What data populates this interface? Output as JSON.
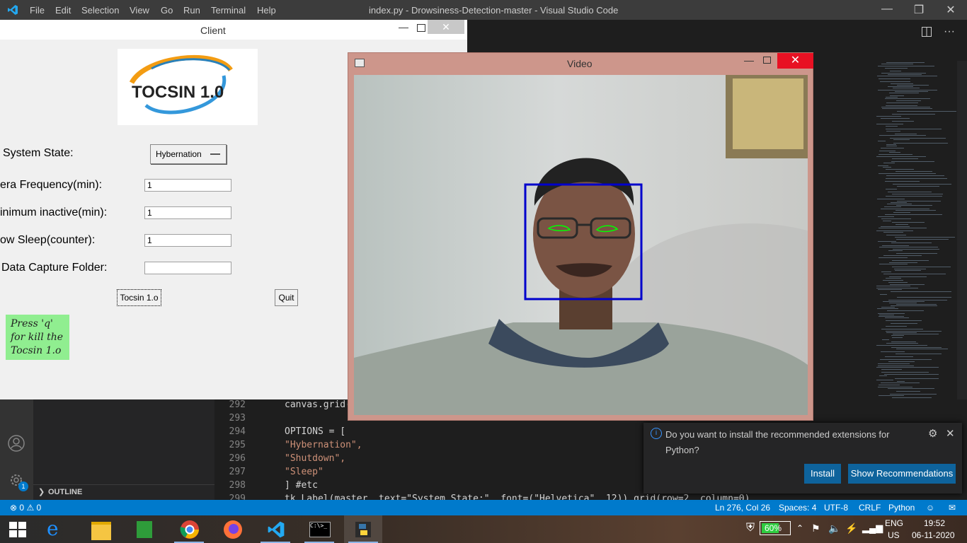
{
  "vscode": {
    "menu": [
      "File",
      "Edit",
      "Selection",
      "View",
      "Go",
      "Run",
      "Terminal",
      "Help"
    ],
    "title": "index.py - Drowsiness-Detection-master - Visual Studio Code",
    "outline_label": "OUTLINE",
    "settings_badge": "1",
    "editor_lines": [
      {
        "num": "292",
        "code": "canvas.grid("
      },
      {
        "num": "293",
        "code": ""
      },
      {
        "num": "294",
        "code": "OPTIONS = ["
      },
      {
        "num": "295",
        "code": "\"Hybernation\","
      },
      {
        "num": "296",
        "code": "\"Shutdown\","
      },
      {
        "num": "297",
        "code": "\"Sleep\""
      },
      {
        "num": "298",
        "code": "] #etc"
      },
      {
        "num": "299",
        "code": "tk.Label(master, text=\"System State:\", font=(\"Helvetica\", 12)).grid(row=2, column=0)"
      }
    ],
    "status": {
      "errors": "0",
      "warnings": "0",
      "position": "Ln 276, Col 26",
      "spaces": "Spaces: 4",
      "encoding": "UTF-8",
      "eol": "CRLF",
      "language": "Python"
    },
    "notification": {
      "message": "Do you want to install the recommended extensions for Python?",
      "install": "Install",
      "show_recommendations": "Show Recommendations"
    }
  },
  "client": {
    "title": "Client",
    "logo_text": "TOCSIN 1.0",
    "system_state_label": "System State:",
    "system_state_value": "Hybernation",
    "camera_frequency_label": "era Frequency(min):",
    "camera_frequency_value": "1",
    "min_inactive_label": "inimum inactive(min):",
    "min_inactive_value": "1",
    "allow_sleep_label": "ow Sleep(counter):",
    "allow_sleep_value": "1",
    "capture_folder_label": "Data Capture Folder:",
    "capture_folder_value": "",
    "start_button": "Tocsin 1.o",
    "quit_button": "Quit",
    "hint_text": "Press 'q' for kill the Tocsin 1.o"
  },
  "video": {
    "title": "Video"
  },
  "taskbar": {
    "battery": "60%",
    "language": "ENG",
    "region": "US",
    "time": "19:52",
    "date": "06-11-2020"
  },
  "colors": {
    "vscode_blue": "#007acc",
    "face_box": "#0000cc",
    "eye_contour": "#00ff00",
    "hint_bg": "#90ee90",
    "video_frame": "#cd968b"
  }
}
